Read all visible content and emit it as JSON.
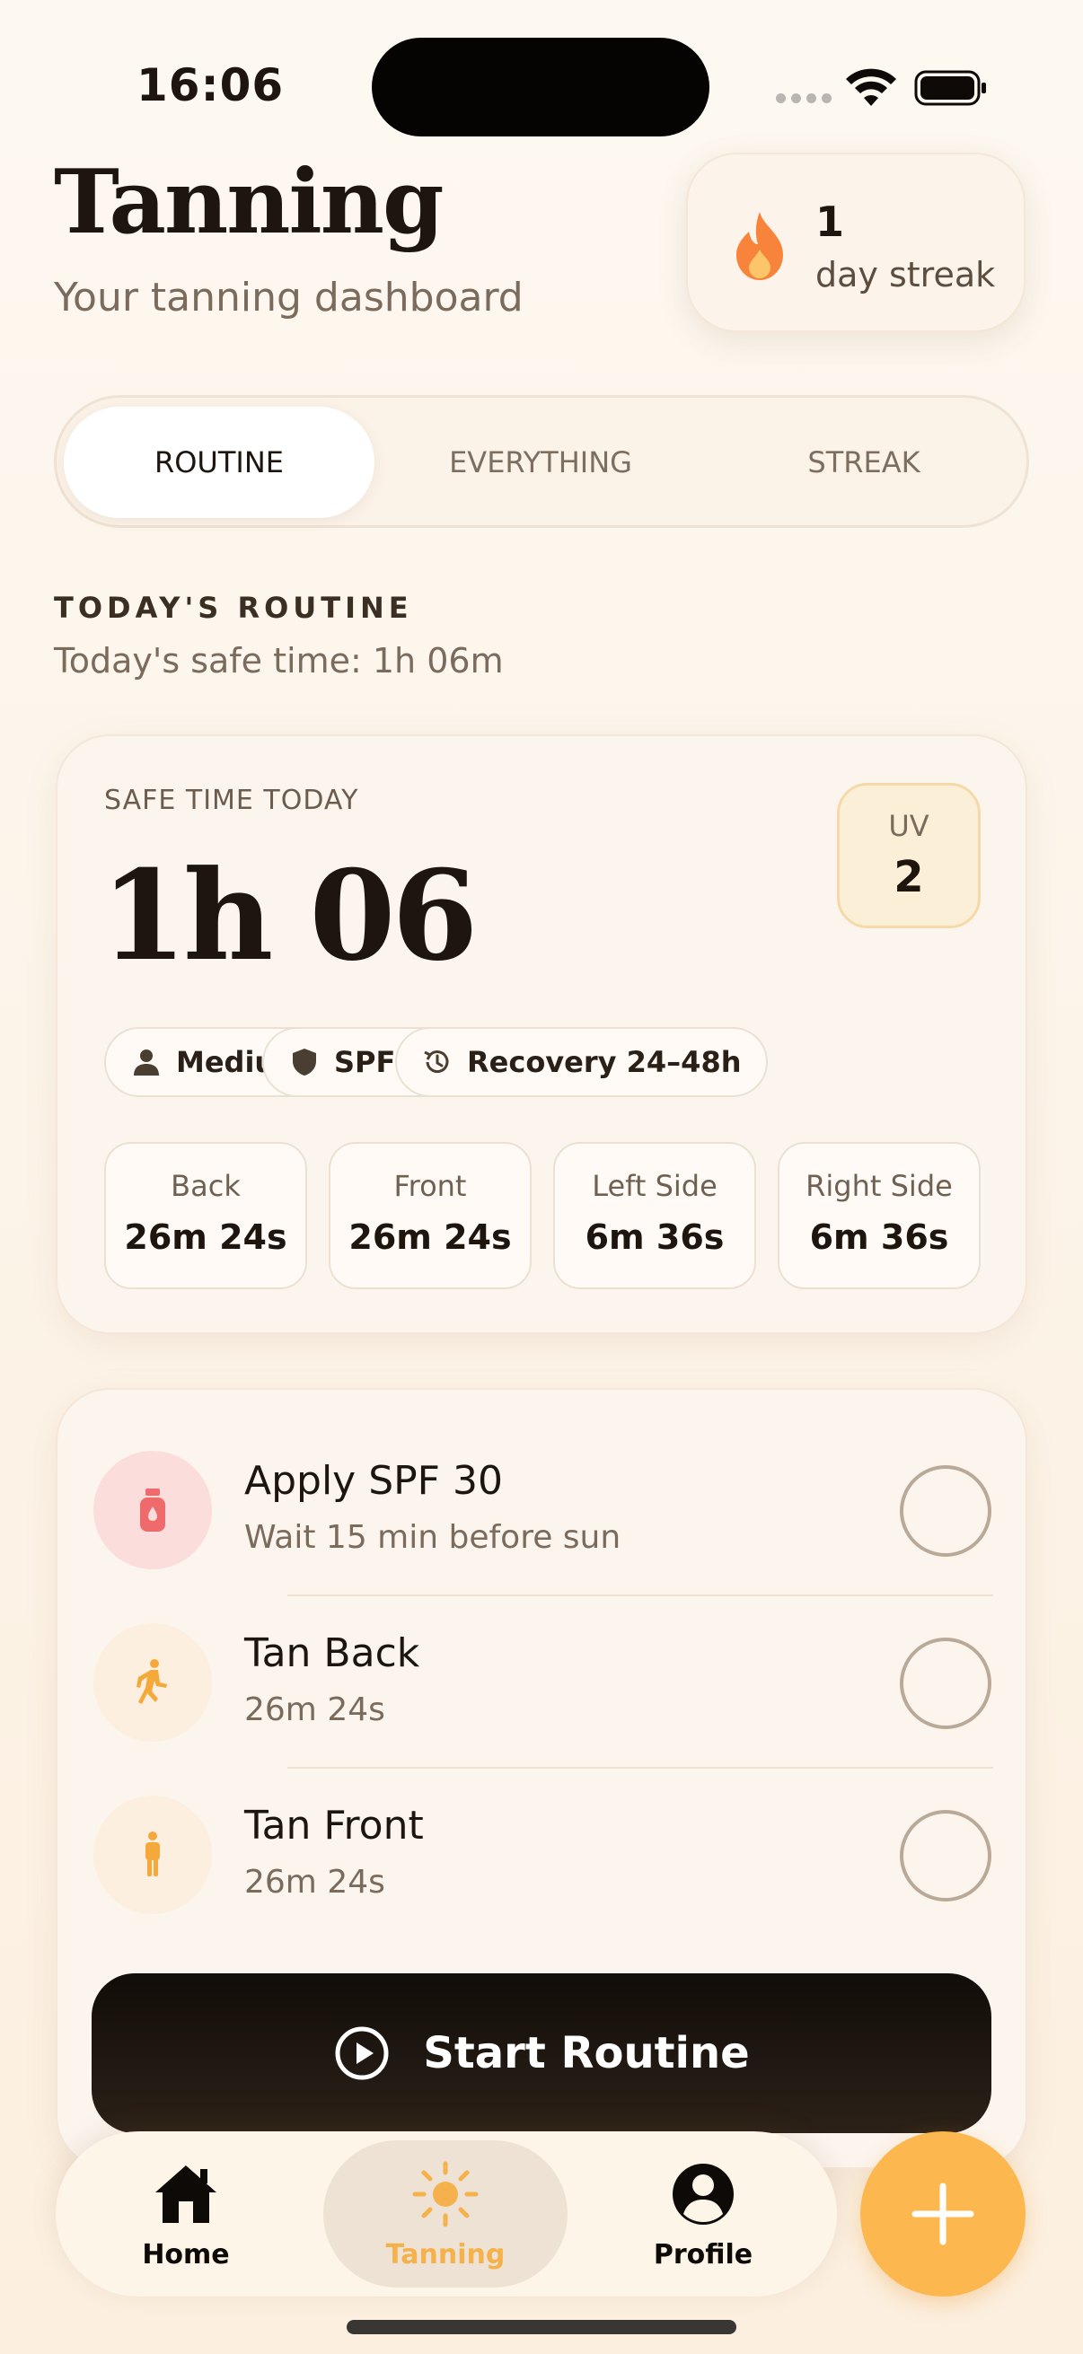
{
  "status_bar": {
    "time": "16:06"
  },
  "header": {
    "title": "Tanning",
    "subtitle": "Your tanning dashboard",
    "streak": {
      "count": "1",
      "label": "day streak"
    }
  },
  "tabs": [
    {
      "label": "ROUTINE",
      "active": true
    },
    {
      "label": "EVERYTHING",
      "active": false
    },
    {
      "label": "STREAK",
      "active": false
    }
  ],
  "section": {
    "title": "TODAY'S ROUTINE",
    "subtitle": "Today's safe time: 1h 06m"
  },
  "safe_time": {
    "label": "SAFE TIME TODAY",
    "value": "1h 06",
    "uv": {
      "label": "UV",
      "value": "2"
    },
    "pills": [
      {
        "icon": "person-icon",
        "label": "Medium"
      },
      {
        "icon": "shield-icon",
        "label": "SPF 30"
      },
      {
        "icon": "history-icon",
        "label": "Recovery 24–48h"
      }
    ],
    "parts": [
      {
        "name": "Back",
        "time": "26m 24s"
      },
      {
        "name": "Front",
        "time": "26m 24s"
      },
      {
        "name": "Left Side",
        "time": "6m 36s"
      },
      {
        "name": "Right Side",
        "time": "6m 36s"
      }
    ]
  },
  "routine": {
    "steps": [
      {
        "icon": "sunscreen-bottle-icon",
        "title": "Apply SPF 30",
        "subtitle": "Wait 15 min before sun",
        "done": false
      },
      {
        "icon": "walking-person-icon",
        "title": "Tan Back",
        "subtitle": "26m 24s",
        "done": false
      },
      {
        "icon": "standing-person-icon",
        "title": "Tan Front",
        "subtitle": "26m 24s",
        "done": false
      }
    ],
    "start_label": "Start Routine"
  },
  "bottom_nav": {
    "items": [
      {
        "icon": "house-icon",
        "label": "Home",
        "active": false
      },
      {
        "icon": "sun-icon",
        "label": "Tanning",
        "active": true
      },
      {
        "icon": "profile-icon",
        "label": "Profile",
        "active": false
      }
    ],
    "fab_icon": "plus-icon"
  },
  "colors": {
    "accent": "#fdb74f",
    "background": "#fdf8f1",
    "text": "#1d150e",
    "muted": "#7a6b5c",
    "flame": "#f7843a",
    "sunscreen_bg": "#fbdedc",
    "person_bg": "#fcefdf"
  }
}
